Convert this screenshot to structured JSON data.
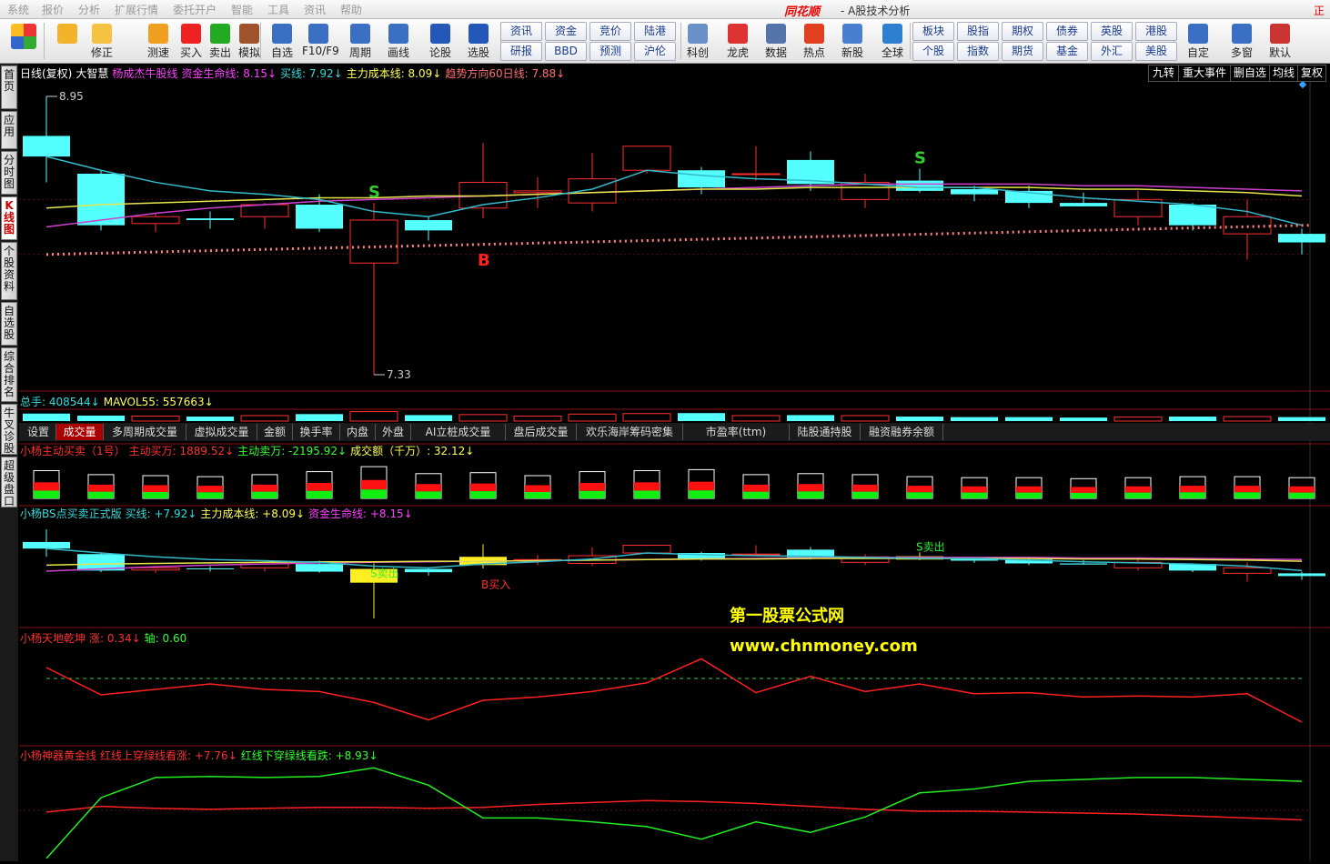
{
  "menu": [
    "系统",
    "报价",
    "分析",
    "扩展行情",
    "委托开户",
    "智能",
    "工具",
    "资讯",
    "帮助"
  ],
  "app": {
    "logo": "同花顺",
    "title": "- A股技术分析",
    "corner": "正片"
  },
  "toolbar": {
    "left_buttons": [
      {
        "label": "",
        "icon": "layout-icon"
      },
      {
        "label": "",
        "icon": "back-arrow-icon"
      },
      {
        "label": "修正",
        "icon": "updown-icon"
      },
      {
        "label": "测速",
        "icon": "speed-icon"
      },
      {
        "label": "买入",
        "icon": "buy-icon"
      },
      {
        "label": "卖出",
        "icon": "sell-icon"
      },
      {
        "label": "模拟",
        "icon": "hammer-icon"
      },
      {
        "label": "自选",
        "icon": "star-icon"
      },
      {
        "label": "F10/F9",
        "icon": "doc-icon"
      },
      {
        "label": "周期",
        "icon": "clock-icon"
      },
      {
        "label": "画线",
        "icon": "pencil-icon"
      },
      {
        "label": "论股",
        "icon": "discuss-icon"
      },
      {
        "label": "选股",
        "icon": "magnify-icon"
      }
    ],
    "grid1": [
      "资讯",
      "资金",
      "竞价",
      "陆港",
      "研报",
      "BBD",
      "预测",
      "沪伦"
    ],
    "mid_buttons": [
      {
        "label": "科创",
        "icon": "kechuang-icon"
      },
      {
        "label": "龙虎",
        "icon": "dragon-icon"
      },
      {
        "label": "数据",
        "icon": "pe-icon"
      },
      {
        "label": "热点",
        "icon": "hot-icon"
      },
      {
        "label": "新股",
        "icon": "ipo-icon"
      },
      {
        "label": "全球",
        "icon": "globe-icon"
      }
    ],
    "grid2": [
      "板块",
      "股指",
      "期权",
      "债券",
      "英股",
      "港股",
      "个股",
      "指数",
      "期货",
      "基金",
      "外汇",
      "美股"
    ],
    "right_buttons": [
      {
        "label": "自定",
        "icon": "custom-icon"
      },
      {
        "label": "多窗",
        "icon": "multiwin-icon"
      },
      {
        "label": "默认",
        "icon": "home-icon"
      }
    ]
  },
  "side_tabs": [
    "首页",
    "应用",
    "分时图",
    "K线图",
    "个股资料",
    "自选股",
    "综合排名",
    "牛叉诊股",
    "超级盘口"
  ],
  "right_tabs": [
    "九转",
    "重大事件",
    "删自选",
    "均线",
    "复权"
  ],
  "panel1": {
    "items": [
      {
        "text": "日线(复权)",
        "color": "#ffffff"
      },
      {
        "text": "大智慧",
        "color": "#ffffff"
      },
      {
        "text": "杨成杰牛股线",
        "color": "#ff40ff"
      },
      {
        "text": "资金生命线: 8.15↓",
        "color": "#ff40ff"
      },
      {
        "text": "买线: 7.92↓",
        "color": "#33dddd"
      },
      {
        "text": "主力成本线: 8.09↓",
        "color": "#ffff55"
      },
      {
        "text": "趋势方向60日线: 7.88↓",
        "color": "#ff7070"
      }
    ],
    "high_label": "8.95",
    "low_label": "7.33"
  },
  "panel2": {
    "items": [
      {
        "text": "总手: 408544↓",
        "color": "#33dddd"
      },
      {
        "text": "MAVOL55: 557663↓",
        "color": "#ffff55"
      }
    ]
  },
  "indicator_tabs": [
    "设置",
    "成交量",
    "多周期成交量",
    "虚拟成交量",
    "金额",
    "换手率",
    "内盘",
    "外盘",
    "AI立桩成交量",
    "盘后成交量",
    "欢乐海岸筹码密集",
    "市盈率(ttm)",
    "陆股通持股",
    "融资融券余额"
  ],
  "indicator_active": "成交量",
  "panel3": {
    "items": [
      {
        "text": "小杨主动买卖（1号）",
        "color": "#ff3030"
      },
      {
        "text": "主动买万: 1889.52↓",
        "color": "#ff3030"
      },
      {
        "text": "主动卖万: -2195.92↓",
        "color": "#33ff33"
      },
      {
        "text": "成交额（千万）: 32.12↓",
        "color": "#ffff55"
      }
    ]
  },
  "panel4": {
    "items": [
      {
        "text": "小杨BS点买卖正式版",
        "color": "#33dddd"
      },
      {
        "text": "买线: +7.92↓",
        "color": "#33dddd"
      },
      {
        "text": "主力成本线: +8.09↓",
        "color": "#ffff55"
      },
      {
        "text": "资金生命线: +8.15↓",
        "color": "#ff40ff"
      }
    ]
  },
  "panel5": {
    "items": [
      {
        "text": "小杨天地乾坤",
        "color": "#ff3030"
      },
      {
        "text": "涨: 0.34↓",
        "color": "#ff3030"
      },
      {
        "text": "轴: 0.60",
        "color": "#33ff33"
      }
    ]
  },
  "panel6": {
    "items": [
      {
        "text": "小杨神器黄金线",
        "color": "#ff3030"
      },
      {
        "text": "红线上穿绿线看涨: +7.76↓",
        "color": "#ff3030"
      },
      {
        "text": "红线下穿绿线看跌: +8.93↓",
        "color": "#33ff33"
      }
    ]
  },
  "signals": {
    "sell": "S",
    "buy": "B",
    "sell_text": "S卖出",
    "buy_text": "B买入"
  },
  "watermark": {
    "line1": "第一股票公式网",
    "line2": "www.chnmoney.com"
  },
  "colors": {
    "up": "#ff3030",
    "down": "#54ffff",
    "buyline": "#33bbcc",
    "costline": "#e6e64a",
    "lifeline": "#d040d0"
  },
  "chart_data": {
    "type": "candlestick",
    "price_range": [
      7.33,
      8.95
    ],
    "candles": [
      {
        "o": 8.72,
        "h": 8.95,
        "l": 8.45,
        "c": 8.6,
        "v": 0.75
      },
      {
        "o": 8.5,
        "h": 8.52,
        "l": 8.17,
        "c": 8.2,
        "v": 0.55
      },
      {
        "o": 8.21,
        "h": 8.27,
        "l": 8.16,
        "c": 8.25,
        "v": 0.5
      },
      {
        "o": 8.24,
        "h": 8.28,
        "l": 8.18,
        "c": 8.23,
        "v": 0.45
      },
      {
        "o": 8.25,
        "h": 8.33,
        "l": 8.18,
        "c": 8.32,
        "v": 0.55
      },
      {
        "o": 8.32,
        "h": 8.38,
        "l": 8.16,
        "c": 8.18,
        "v": 0.7
      },
      {
        "o": 7.98,
        "h": 8.33,
        "l": 7.33,
        "c": 8.23,
        "v": 0.95
      },
      {
        "o": 8.23,
        "h": 8.25,
        "l": 8.11,
        "c": 8.17,
        "v": 0.6
      },
      {
        "o": 8.3,
        "h": 8.68,
        "l": 8.24,
        "c": 8.45,
        "v": 0.65
      },
      {
        "o": 8.39,
        "h": 8.48,
        "l": 8.3,
        "c": 8.4,
        "v": 0.5
      },
      {
        "o": 8.33,
        "h": 8.62,
        "l": 8.28,
        "c": 8.47,
        "v": 0.7
      },
      {
        "o": 8.52,
        "h": 8.66,
        "l": 8.5,
        "c": 8.66,
        "v": 0.75
      },
      {
        "o": 8.52,
        "h": 8.54,
        "l": 8.38,
        "c": 8.42,
        "v": 0.8
      },
      {
        "o": 8.5,
        "h": 8.66,
        "l": 8.46,
        "c": 8.5,
        "v": 0.55
      },
      {
        "o": 8.58,
        "h": 8.63,
        "l": 8.4,
        "c": 8.44,
        "v": 0.6
      },
      {
        "o": 8.35,
        "h": 8.5,
        "l": 8.3,
        "c": 8.45,
        "v": 0.55
      },
      {
        "o": 8.46,
        "h": 8.53,
        "l": 8.39,
        "c": 8.4,
        "v": 0.45
      },
      {
        "o": 8.41,
        "h": 8.43,
        "l": 8.34,
        "c": 8.38,
        "v": 0.4
      },
      {
        "o": 8.4,
        "h": 8.43,
        "l": 8.3,
        "c": 8.33,
        "v": 0.4
      },
      {
        "o": 8.33,
        "h": 8.39,
        "l": 8.31,
        "c": 8.31,
        "v": 0.35
      },
      {
        "o": 8.25,
        "h": 8.4,
        "l": 8.2,
        "c": 8.35,
        "v": 0.4
      },
      {
        "o": 8.32,
        "h": 8.33,
        "l": 8.17,
        "c": 8.2,
        "v": 0.45
      },
      {
        "o": 8.15,
        "h": 8.35,
        "l": 8.0,
        "c": 8.25,
        "v": 0.45
      },
      {
        "o": 8.15,
        "h": 8.18,
        "l": 8.03,
        "c": 8.1,
        "v": 0.4
      }
    ],
    "buy_line": [
      8.6,
      8.52,
      8.45,
      8.4,
      8.38,
      8.35,
      8.28,
      8.25,
      8.32,
      8.36,
      8.41,
      8.52,
      8.49,
      8.47,
      8.46,
      8.44,
      8.42,
      8.42,
      8.39,
      8.36,
      8.34,
      8.32,
      8.28,
      8.2
    ],
    "cost_line": [
      8.3,
      8.32,
      8.33,
      8.34,
      8.35,
      8.36,
      8.36,
      8.37,
      8.37,
      8.38,
      8.39,
      8.4,
      8.41,
      8.41,
      8.42,
      8.42,
      8.42,
      8.42,
      8.42,
      8.41,
      8.41,
      8.4,
      8.39,
      8.37
    ],
    "life_line": [
      8.19,
      8.23,
      8.27,
      8.3,
      8.32,
      8.34,
      8.35,
      8.36,
      8.37,
      8.38,
      8.39,
      8.4,
      8.41,
      8.42,
      8.43,
      8.44,
      8.44,
      8.44,
      8.44,
      8.43,
      8.43,
      8.42,
      8.41,
      8.4
    ],
    "trend_start": 8.03,
    "trend_end": 8.2,
    "tiandi": [
      0.7,
      0.45,
      0.5,
      0.55,
      0.5,
      0.48,
      0.38,
      0.22,
      0.4,
      0.43,
      0.48,
      0.56,
      0.78,
      0.47,
      0.62,
      0.48,
      0.55,
      0.46,
      0.47,
      0.43,
      0.44,
      0.43,
      0.46,
      0.2
    ],
    "tiandi_axis": 0.6,
    "gold_red": [
      0.5,
      0.56,
      0.54,
      0.53,
      0.54,
      0.55,
      0.55,
      0.54,
      0.55,
      0.58,
      0.6,
      0.62,
      0.61,
      0.59,
      0.56,
      0.53,
      0.51,
      0.51,
      0.5,
      0.49,
      0.48,
      0.46,
      0.44,
      0.42
    ],
    "gold_green": [
      0.02,
      0.65,
      0.86,
      0.87,
      0.86,
      0.87,
      0.96,
      0.78,
      0.44,
      0.44,
      0.4,
      0.35,
      0.22,
      0.4,
      0.29,
      0.45,
      0.7,
      0.74,
      0.82,
      0.84,
      0.86,
      0.86,
      0.84,
      0.82
    ],
    "sell_signals": [
      6,
      16
    ],
    "buy_signals": [
      8
    ]
  }
}
